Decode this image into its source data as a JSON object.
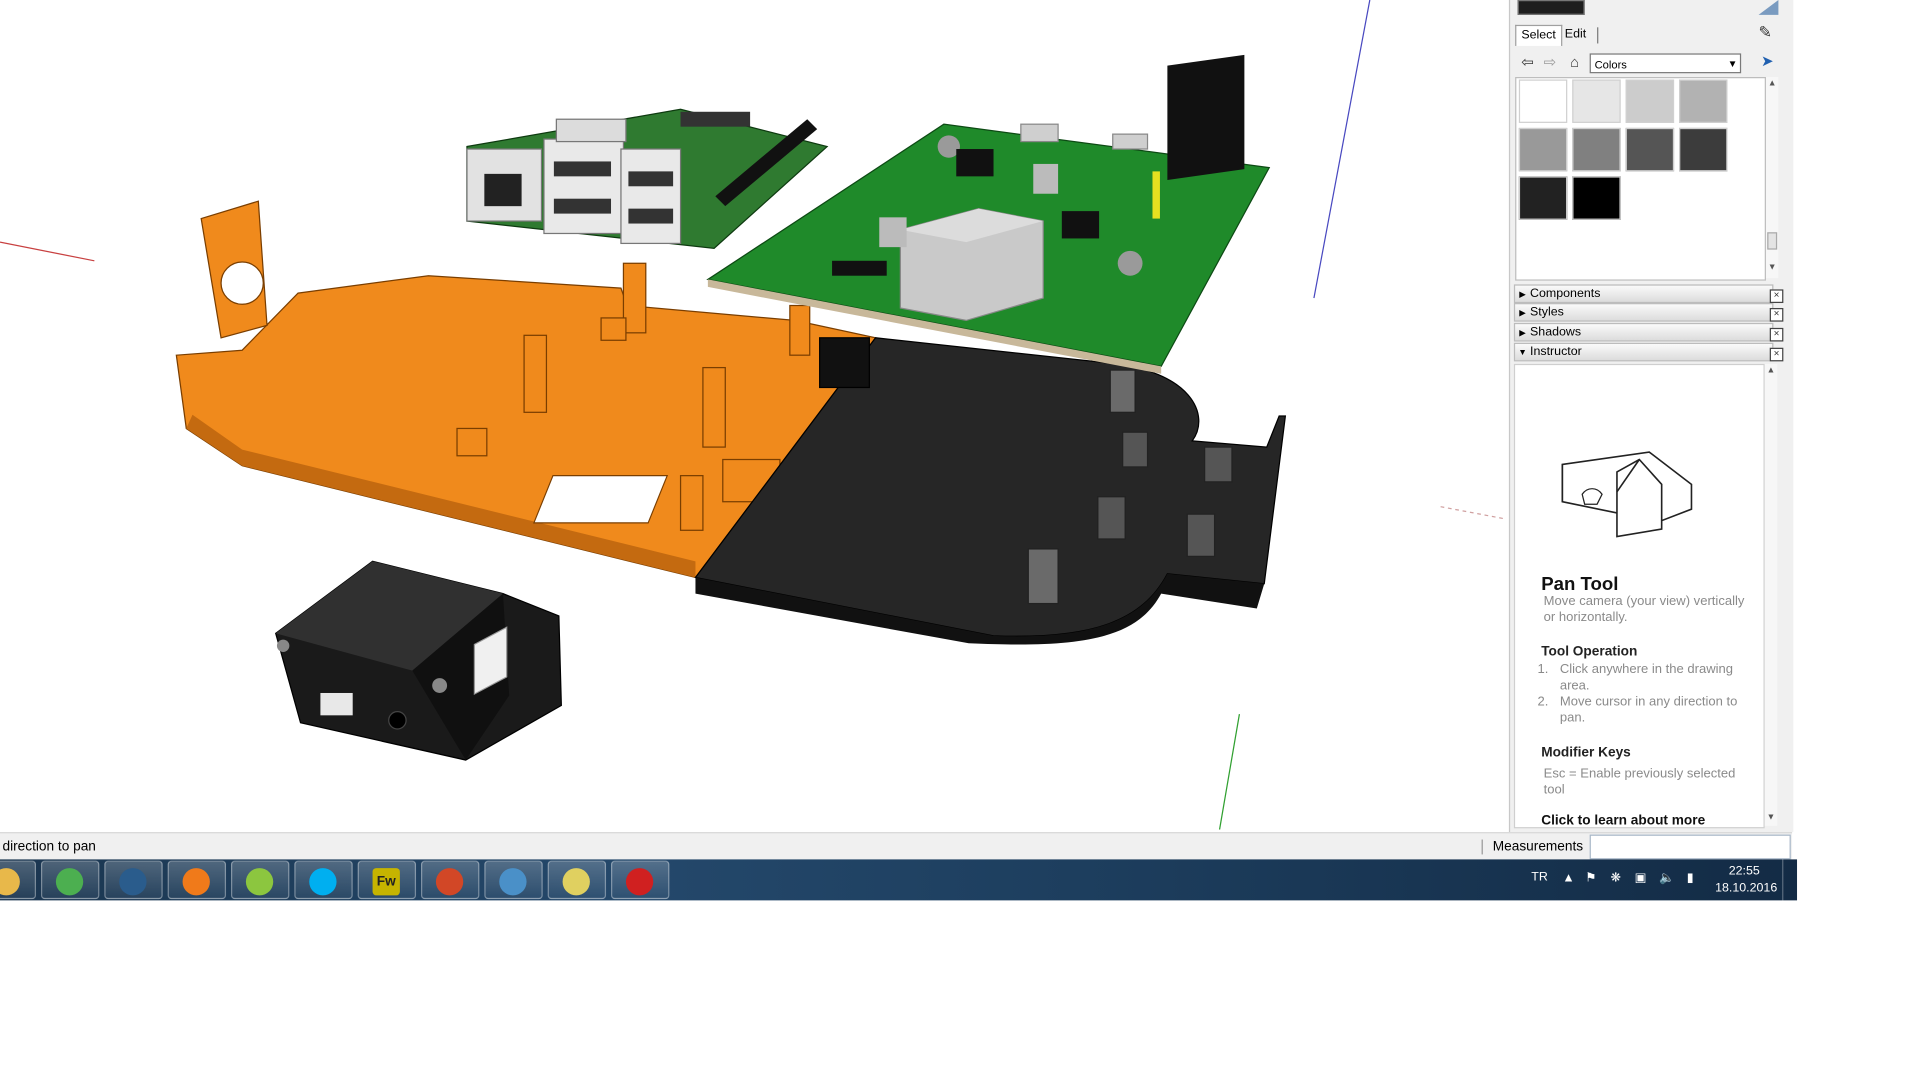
{
  "statusbar": {
    "hint": "direction to pan",
    "measurements_label": "Measurements",
    "measurements_value": ""
  },
  "materials": {
    "tabs": [
      "Select",
      "Edit"
    ],
    "active_tab": "Select",
    "library": "Colors",
    "swatches": [
      "#ffffff",
      "#e6e6e6",
      "#cccccc",
      "#b2b2b2",
      "#999999",
      "#808080",
      "#555555",
      "#3c3c3c",
      "#222222",
      "#000000"
    ]
  },
  "panels": [
    {
      "label": "Components",
      "expanded": false
    },
    {
      "label": "Styles",
      "expanded": false
    },
    {
      "label": "Shadows",
      "expanded": false
    },
    {
      "label": "Instructor",
      "expanded": true
    }
  ],
  "instructor": {
    "title": "Pan Tool",
    "description": "Move camera (your view) vertically or horizontally.",
    "operation_heading": "Tool Operation",
    "steps": [
      {
        "num": "1.",
        "text": "Click anywhere in the drawing area."
      },
      {
        "num": "2.",
        "text": "Move cursor in any direction to pan."
      }
    ],
    "modifier_heading": "Modifier Keys",
    "modifier_text": "Esc = Enable previously selected tool",
    "learn_more": "Click to learn about more"
  },
  "taskbar": {
    "apps": [
      {
        "name": "windows-explorer-icon",
        "color": "#e8b84a"
      },
      {
        "name": "chrome-icon",
        "color": "#4caf50"
      },
      {
        "name": "app-circle-icon",
        "color": "#2a5c8c"
      },
      {
        "name": "firefox-icon",
        "color": "#f07a1a"
      },
      {
        "name": "green-ring-icon",
        "color": "#8cc63f"
      },
      {
        "name": "skype-icon",
        "color": "#00aff0"
      },
      {
        "name": "fireworks-icon",
        "color": "#c6b400",
        "text": "Fw"
      },
      {
        "name": "presentation-icon",
        "color": "#d24726"
      },
      {
        "name": "remote-desktop-icon",
        "color": "#4a90c8"
      },
      {
        "name": "penguin-icon",
        "color": "#e0d060"
      },
      {
        "name": "sketchup-icon",
        "color": "#d02020"
      }
    ],
    "language": "TR",
    "time": "22:55",
    "date": "18.10.2016"
  },
  "colors": {
    "orange_part": "#f08a1c",
    "black_part": "#1c1c1c",
    "pcb_green": "#1f8a2a"
  }
}
